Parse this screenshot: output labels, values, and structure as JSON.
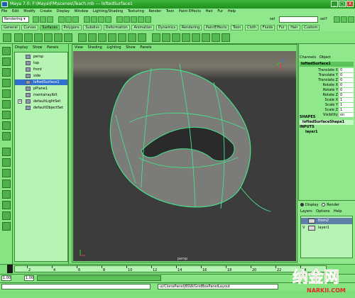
{
  "window": {
    "title": "Maya 7.0: F:\\Maya\\FM\\scenes\\Teach.mb  ---  loftedSurface1",
    "min": "_",
    "max": "□",
    "close": "X"
  },
  "menubar": [
    "File",
    "Edit",
    "Modify",
    "Create",
    "Display",
    "Window",
    "Lighting/Shading",
    "Texturing",
    "Render",
    "Toon",
    "Paint Effects",
    "Hair",
    "Fur",
    "Help"
  ],
  "toolbar": {
    "mode": "Rendering",
    "cmd_label": "sel",
    "sel_label": "sel?"
  },
  "shelf_tabs": [
    {
      "label": "General",
      "active": false
    },
    {
      "label": "Curves",
      "active": false
    },
    {
      "label": "Surfaces",
      "active": true
    },
    {
      "label": "Polygons",
      "active": false
    },
    {
      "label": "Subdivs",
      "active": false
    },
    {
      "label": "Deformation",
      "active": false
    },
    {
      "label": "Animation",
      "active": false
    },
    {
      "label": "Dynamics",
      "active": false
    },
    {
      "label": "Rendering",
      "active": false
    },
    {
      "label": "PaintEffects",
      "active": false
    },
    {
      "label": "Toon",
      "active": false
    },
    {
      "label": "Cloth",
      "active": false
    },
    {
      "label": "Fluids",
      "active": false
    },
    {
      "label": "Fur",
      "active": false
    },
    {
      "label": "Hair",
      "active": false
    },
    {
      "label": "Custom",
      "active": false
    }
  ],
  "outliner": {
    "menu": [
      "Display",
      "Show",
      "Panels"
    ],
    "items": [
      {
        "label": "persp",
        "selected": false,
        "expand": false
      },
      {
        "label": "top",
        "selected": false,
        "expand": false
      },
      {
        "label": "front",
        "selected": false,
        "expand": false
      },
      {
        "label": "side",
        "selected": false,
        "expand": false
      },
      {
        "label": "loftedSurface1",
        "selected": true,
        "expand": false
      },
      {
        "label": "pPlane1",
        "selected": false,
        "expand": false
      },
      {
        "label": "mentalrayIblt",
        "selected": false,
        "expand": false
      },
      {
        "label": "defaultLightSet",
        "selected": false,
        "expand": true
      },
      {
        "label": "defaultObjectSet",
        "selected": false,
        "expand": false
      }
    ]
  },
  "viewport": {
    "menu": [
      "View",
      "Shading",
      "Lighting",
      "Show",
      "Panels"
    ],
    "camera_label": "persp"
  },
  "channel_box": {
    "menu": [
      "Channels",
      "Object"
    ],
    "object_name": "loftedSurface1",
    "channels": [
      {
        "label": "Translate X",
        "value": "0"
      },
      {
        "label": "Translate Y",
        "value": "0"
      },
      {
        "label": "Translate Z",
        "value": "0"
      },
      {
        "label": "Rotate X",
        "value": "0"
      },
      {
        "label": "Rotate Y",
        "value": "0"
      },
      {
        "label": "Rotate Z",
        "value": "0"
      },
      {
        "label": "Scale X",
        "value": "1"
      },
      {
        "label": "Scale Y",
        "value": "1"
      },
      {
        "label": "Scale Z",
        "value": "1"
      },
      {
        "label": "Visibility",
        "value": "on"
      }
    ],
    "shapes_header": "SHAPES",
    "shape_name": "loftedSurfaceShape1",
    "inputs_header": "INPUTS",
    "input_name": "layer1"
  },
  "layers": {
    "display_label": "Display",
    "render_label": "Render",
    "menu": [
      "Layers",
      "Options",
      "Help"
    ],
    "rows": [
      {
        "vis": "",
        "name": "ttom2",
        "selected": true
      },
      {
        "vis": "V",
        "name": "layer1",
        "selected": false
      }
    ]
  },
  "timeline": {
    "ticks": [
      "2",
      "4",
      "6",
      "8",
      "10",
      "12",
      "14",
      "16",
      "18",
      "20",
      "22",
      "24"
    ]
  },
  "range": {
    "start": "1.00",
    "start2": "1.00"
  },
  "commandline": {
    "result": "ui/ClonePanel|BSW/GridBoxPanelLayout"
  },
  "watermark": {
    "text_main": "纳金网",
    "text_sub": "NARKII.COM"
  },
  "colors": {
    "accent": "#7de07a",
    "title_bar": "#1f8f1d",
    "selection": "#2f6fd0",
    "wire": "#48e08a"
  }
}
